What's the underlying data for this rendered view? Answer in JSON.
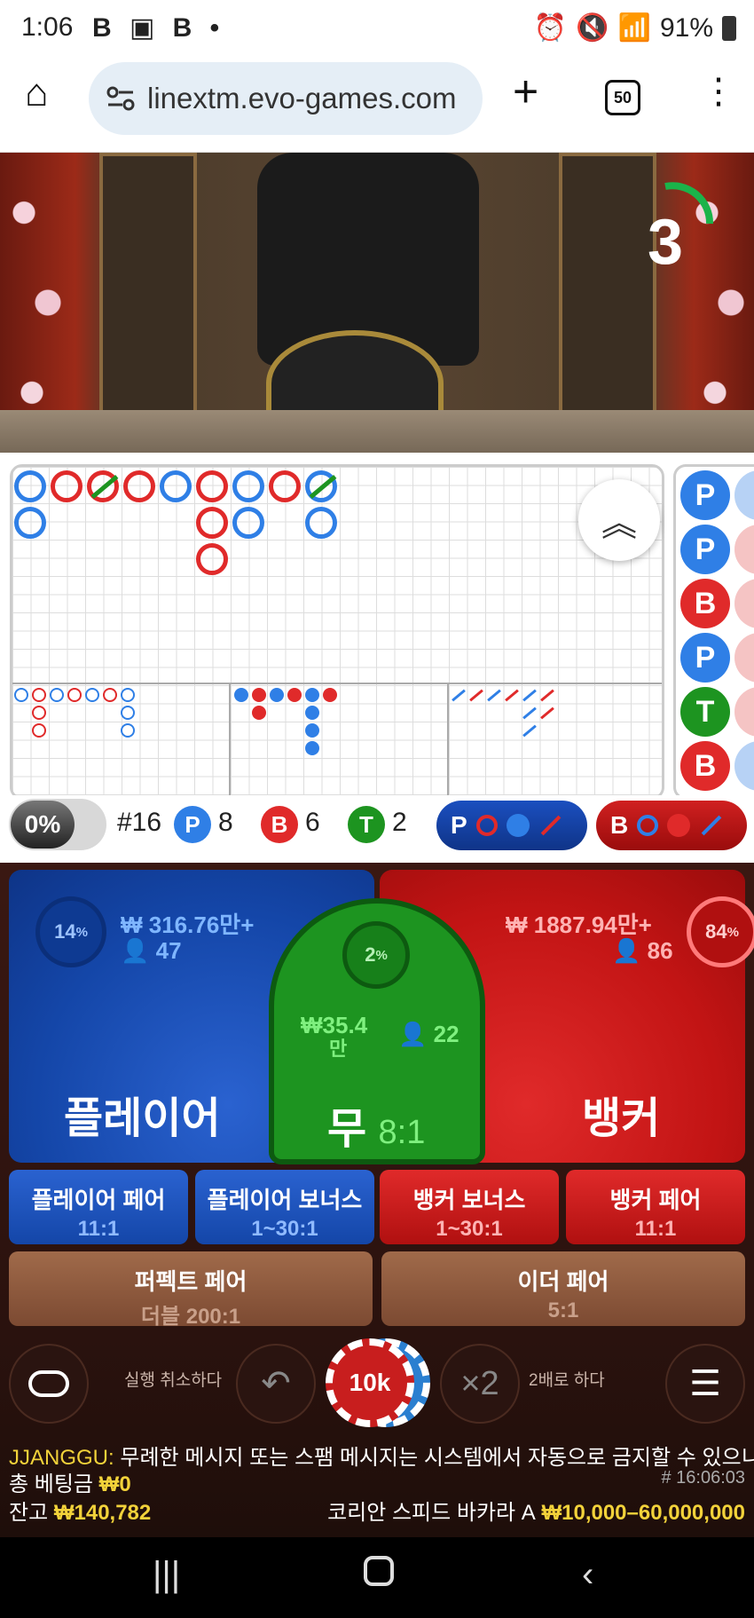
{
  "status_bar": {
    "time": "1:06",
    "app_icons": "B ▣ B •",
    "battery": "91%"
  },
  "browser": {
    "url": "linextm.evo-games.com",
    "tab_count": "50"
  },
  "video": {
    "countdown": "3"
  },
  "stats": {
    "toggle_label": "0%",
    "round": "#16",
    "player_letter": "P",
    "player_count": "8",
    "banker_letter": "B",
    "banker_count": "6",
    "tie_letter": "T",
    "tie_count": "2",
    "predict_player_letter": "P",
    "predict_banker_letter": "B"
  },
  "roadmap": {
    "side_beads": [
      "P",
      "P",
      "B",
      "P",
      "T",
      "B"
    ]
  },
  "bets": {
    "player": {
      "label": "플레이어",
      "pct": "14",
      "amount": "₩ 316.76만+",
      "players": "47"
    },
    "banker": {
      "label": "뱅커",
      "pct": "84",
      "amount": "₩ 1887.94만+",
      "players": "86"
    },
    "tie": {
      "label": "무",
      "odds": "8:1",
      "pct": "2",
      "amount_top": "35.4",
      "amount_unit": "만",
      "currency": "₩",
      "players": "22"
    },
    "player_pair": {
      "label": "플레이어 페어",
      "odds": "11:1"
    },
    "player_bonus": {
      "label": "플레이어 보너스",
      "odds": "1~30:1"
    },
    "banker_bonus": {
      "label": "뱅커 보너스",
      "odds": "1~30:1"
    },
    "banker_pair": {
      "label": "뱅커 페어",
      "odds": "11:1"
    },
    "perfect_pair": {
      "label": "퍼펙트 페어",
      "odds": "더블 200:1"
    },
    "either_pair": {
      "label": "이더 페어",
      "odds": "5:1"
    },
    "pct_suffix": "%"
  },
  "controls": {
    "undo_label": "실행 취소하다",
    "chip_value": "10k",
    "double_symbol": "×2",
    "double_label": "2배로 하다"
  },
  "chat": {
    "user": "JJANGGU:",
    "message": "무례한 메시지 또는 스팸 메시지는 시스템에서 자동으로 금지할 수 있으니"
  },
  "footer": {
    "total_bet_label": "총 베팅금",
    "total_bet_value": "₩0",
    "round_id": "# 16:06:03",
    "balance_label": "잔고",
    "balance_value": "₩140,782",
    "table_name": "코리안 스피드 바카라 A",
    "limits": "₩10,000–60,000,000"
  },
  "colors": {
    "player_blue": "#2f7fe6",
    "banker_red": "#e02a2a",
    "tie_green": "#1d9420",
    "gold_yellow": "#f2d23a"
  }
}
